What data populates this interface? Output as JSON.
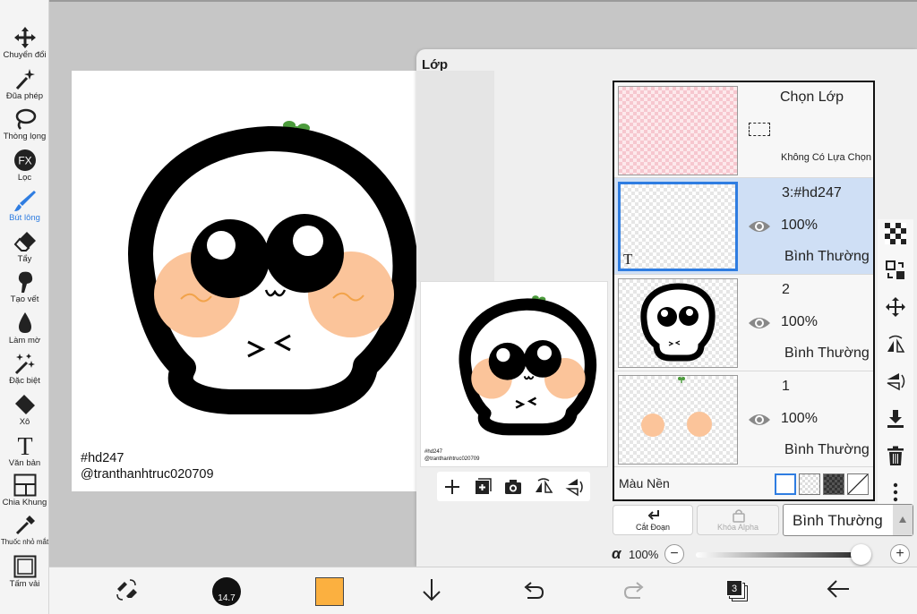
{
  "toolbar": {
    "tools": [
      {
        "label": "Chuyển đổi",
        "icon": "move-arrows-icon"
      },
      {
        "label": "Đũa phép",
        "icon": "magic-wand-icon"
      },
      {
        "label": "Thòng lọng",
        "icon": "lasso-icon"
      },
      {
        "label": "Lọc",
        "icon": "fx-filter-icon"
      },
      {
        "label": "Bút lông",
        "icon": "brush-icon",
        "active": true
      },
      {
        "label": "Tẩy",
        "icon": "eraser-icon"
      },
      {
        "label": "Tạo vết",
        "icon": "smudge-icon"
      },
      {
        "label": "Làm mờ",
        "icon": "blur-drop-icon"
      },
      {
        "label": "Đặc biệt",
        "icon": "special-sparkle-icon"
      },
      {
        "label": "Xô",
        "icon": "bucket-icon"
      },
      {
        "label": "Văn bản",
        "icon": "text-icon"
      },
      {
        "label": "Chia Khung",
        "icon": "frame-divider-icon"
      },
      {
        "label": "Thuốc nhỏ mắt",
        "icon": "eyedropper-icon"
      },
      {
        "label": "Tấm vải",
        "icon": "canvas-icon"
      }
    ]
  },
  "canvas": {
    "watermark_line1": "#hd247",
    "watermark_line2": "@tranthanhtruc020709"
  },
  "panel": {
    "title": "Lớp",
    "preview_watermark_line1": "#hd247",
    "preview_watermark_line2": "@tranthanhtruc020709",
    "selection_layer": {
      "title": "Chọn Lớp",
      "status": "Không Có Lựa Chọn"
    },
    "layers": [
      {
        "name": "3:#hd247",
        "opacity": "100%",
        "blend": "Bình Thường",
        "selected": true,
        "thumb_letter": "T"
      },
      {
        "name": "2",
        "opacity": "100%",
        "blend": "Bình Thường",
        "selected": false
      },
      {
        "name": "1",
        "opacity": "100%",
        "blend": "Bình Thường",
        "selected": false
      }
    ],
    "background_label": "Màu Nền",
    "clip_button": "Cắt Đoạn",
    "alpha_lock_button": "Khóa Alpha",
    "blend_mode": "Bình Thường",
    "alpha_symbol": "α",
    "alpha_value": "100%",
    "alpha_fraction": 1.0
  },
  "bottombar": {
    "brush_size": "14.7",
    "current_color": "#fbb040",
    "layer_count": "3"
  },
  "colors": {
    "accent": "#2f7de1",
    "selected_row": "#cfdff5",
    "blush": "#fbc49a"
  }
}
